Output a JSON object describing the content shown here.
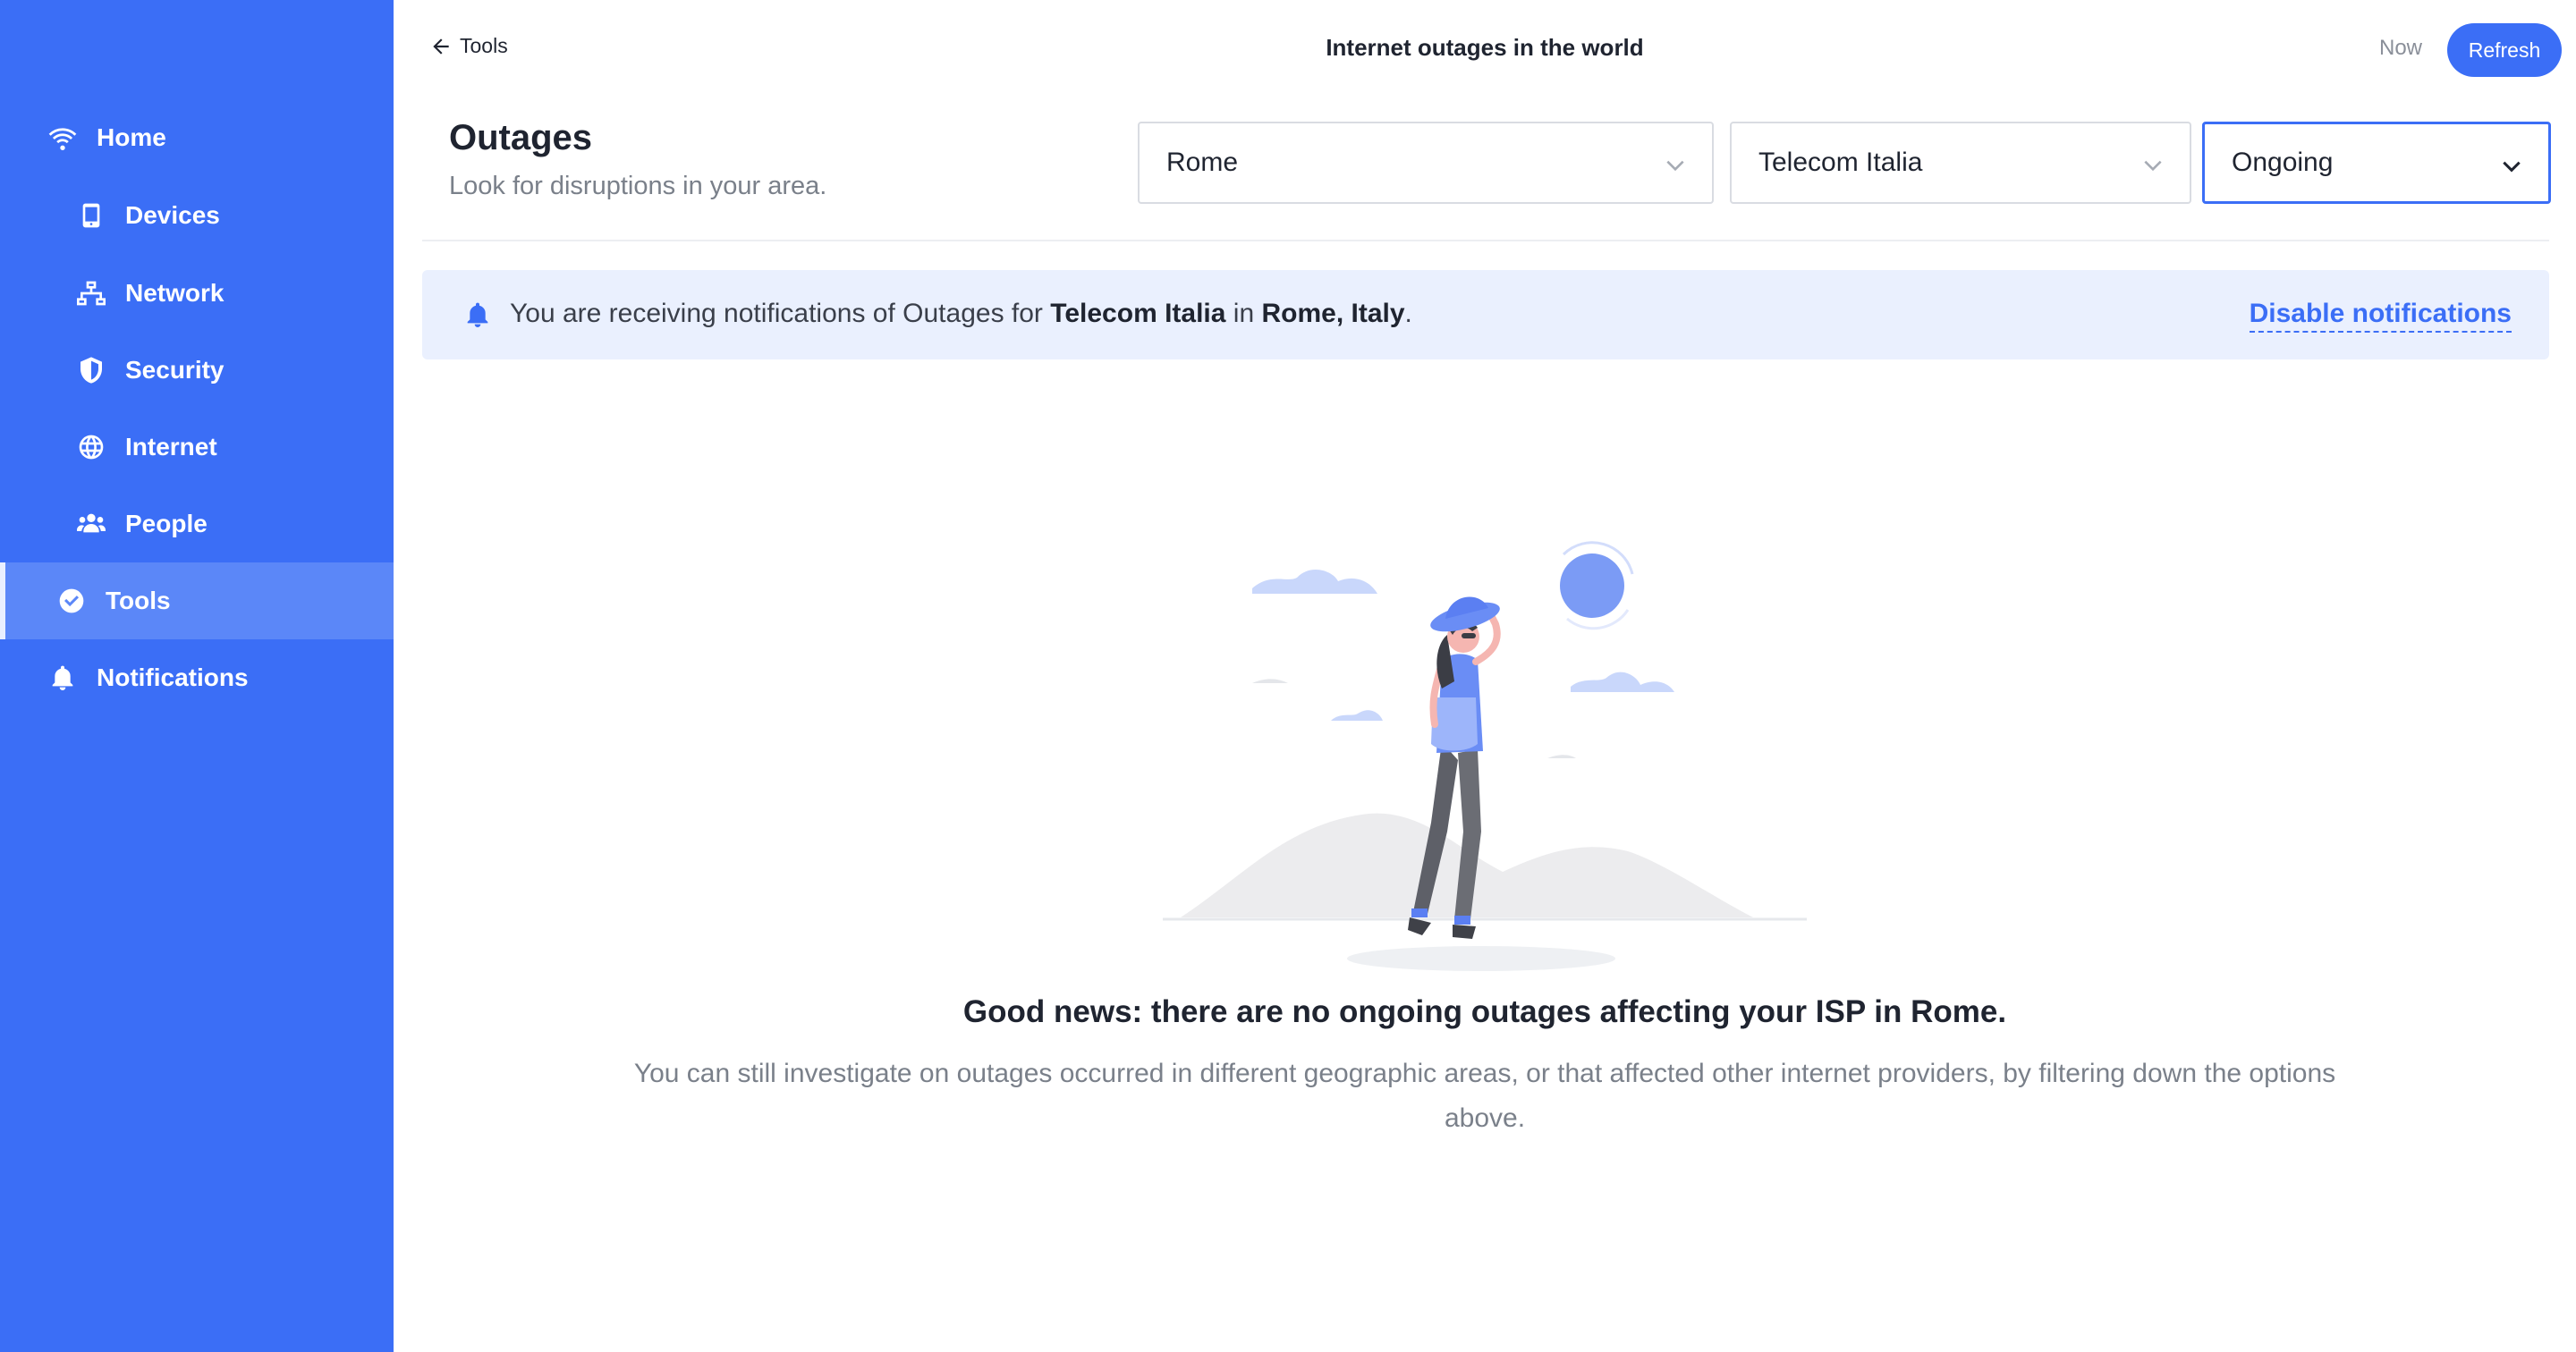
{
  "sidebar": {
    "items": [
      {
        "label": "Home",
        "icon": "wifi-icon"
      },
      {
        "label": "Devices",
        "icon": "mobile-icon"
      },
      {
        "label": "Network",
        "icon": "network-icon"
      },
      {
        "label": "Security",
        "icon": "shield-icon"
      },
      {
        "label": "Internet",
        "icon": "globe-icon"
      },
      {
        "label": "People",
        "icon": "people-icon"
      },
      {
        "label": "Tools",
        "icon": "check-circle-icon",
        "active": true
      },
      {
        "label": "Notifications",
        "icon": "bell-icon"
      }
    ]
  },
  "topbar": {
    "back_label": "Tools",
    "title": "Internet outages in the world",
    "now_label": "Now",
    "refresh_label": "Refresh"
  },
  "section": {
    "title": "Outages",
    "subtitle": "Look for disruptions in your area."
  },
  "filters": {
    "location": "Rome",
    "provider": "Telecom Italia",
    "status": "Ongoing"
  },
  "banner": {
    "prefix": "You are receiving notifications of Outages for ",
    "provider": "Telecom Italia",
    "middle": " in ",
    "location": "Rome, Italy",
    "suffix": ".",
    "action_label": "Disable notifications"
  },
  "empty_state": {
    "title": "Good news: there are no ongoing outages affecting your ISP in Rome.",
    "description": "You can still investigate on outages occurred in different geographic areas, or that affected other internet providers, by filtering down the options above."
  },
  "colors": {
    "primary": "#3b6ef6",
    "sidebar_active": "#5b87f8",
    "banner_bg": "#eaf0fe",
    "muted_text": "#7a808a"
  }
}
